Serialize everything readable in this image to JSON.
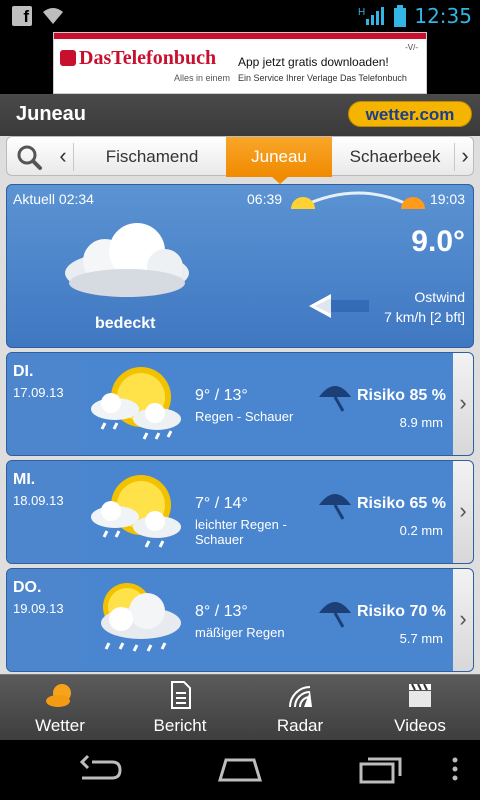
{
  "status_bar": {
    "time": "12:35",
    "fb_letter": "f",
    "network_type": "H"
  },
  "ad": {
    "logo_text": "DasTelefonbuch",
    "slogan": "Alles in einem",
    "headline": "App jetzt gratis downloaden!",
    "subline": "Ein Service Ihrer Verlage Das Telefonbuch",
    "tag": "-V/-"
  },
  "header": {
    "title": "Juneau",
    "brand": "wetter.com"
  },
  "cities": {
    "tabs": [
      "Fischamend",
      "Juneau",
      "Schaerbeek"
    ],
    "active": "Juneau",
    "prev_glyph": "‹",
    "next_glyph": "›"
  },
  "current": {
    "label": "Aktuell 02:34",
    "sunrise": "06:39",
    "sunset": "19:03",
    "condition": "bedeckt",
    "temperature": "9.0°",
    "wind_direction": "Ostwind",
    "wind_speed": "7 km/h [2 bft]"
  },
  "forecast": [
    {
      "day": "DI.",
      "date": "17.09.13",
      "temps": "9° / 13°",
      "description": "Regen - Schauer",
      "risk": "Risiko 85 %",
      "rain": "8.9 mm",
      "chevron": "›"
    },
    {
      "day": "MI.",
      "date": "18.09.13",
      "temps": "7° / 14°",
      "description": "leichter Regen - Schauer",
      "risk": "Risiko 65 %",
      "rain": "0.2 mm",
      "chevron": "›"
    },
    {
      "day": "DO.",
      "date": "19.09.13",
      "temps": "8° / 13°",
      "description": "mäßiger Regen",
      "risk": "Risiko 70 %",
      "rain": "5.7 mm",
      "chevron": "›"
    }
  ],
  "tabbar": [
    "Wetter",
    "Bericht",
    "Radar",
    "Videos"
  ],
  "colors": {
    "accent_orange": "#f08a00",
    "panel_blue": "#4a86cf",
    "brand_yellow": "#f5b400",
    "status_blue": "#33b5e5"
  }
}
